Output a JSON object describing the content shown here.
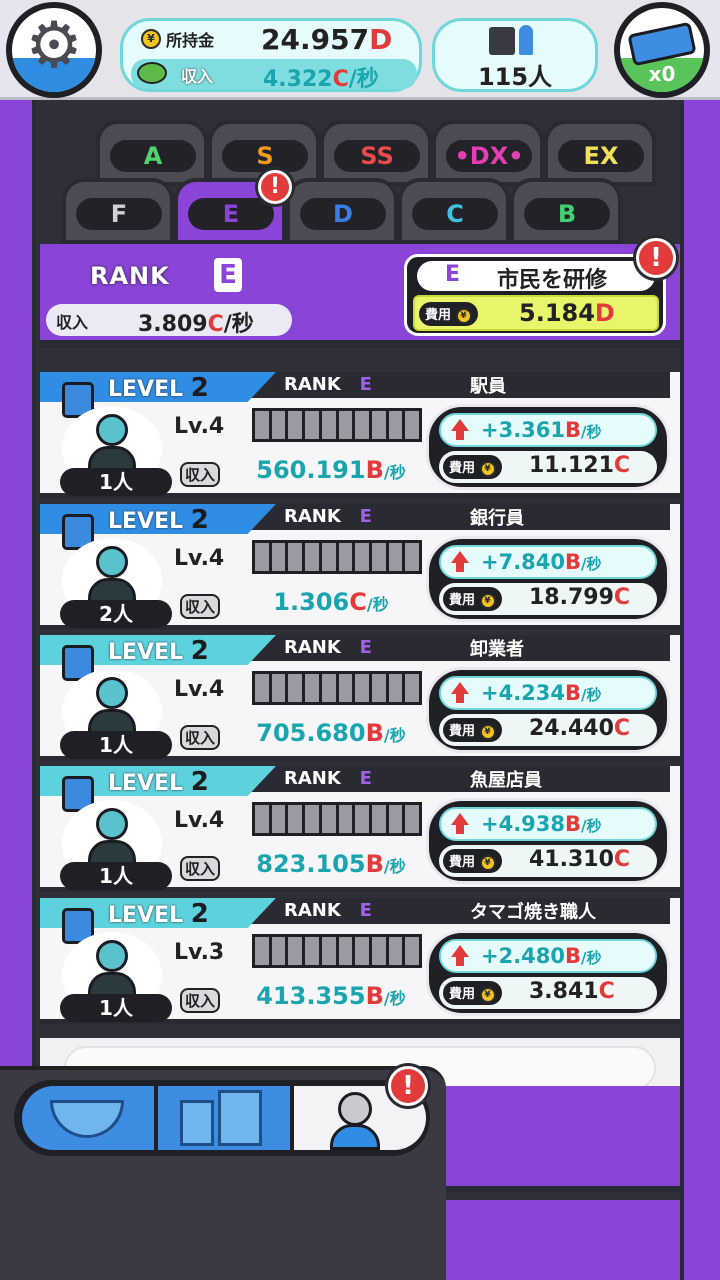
{
  "header": {
    "money_label": "所持金",
    "money_value": "24.957",
    "money_unit": "D",
    "income_label": "収入",
    "income_value": "4.322",
    "income_unit": "C",
    "income_suffix": "/秒",
    "population": "115人",
    "ticket_count": "x0",
    "yen_symbol": "¥"
  },
  "tabs_top": [
    {
      "label": "A",
      "color": "#4fd46a"
    },
    {
      "label": "S",
      "color": "#f39a1e"
    },
    {
      "label": "SS",
      "color": "#ec4a4a"
    },
    {
      "label": "•DX•",
      "color": "#e23fb2"
    },
    {
      "label": "EX",
      "color": "#f2e05a"
    }
  ],
  "tabs_bottom": [
    {
      "label": "F",
      "color": "#d0d0d6"
    },
    {
      "label": "E",
      "color": "#8a44d8",
      "active": true,
      "alert": "!"
    },
    {
      "label": "D",
      "color": "#3b7ee8"
    },
    {
      "label": "C",
      "color": "#3fc3e0"
    },
    {
      "label": "B",
      "color": "#43cf73"
    }
  ],
  "rank_header": {
    "rank_word": "RANK",
    "rank_letter": "E",
    "income_label": "収入",
    "income_value": "3.809",
    "income_unit": "C",
    "income_suffix": "/秒",
    "train_letter": "E",
    "train_title": "市民を研修",
    "cost_label": "費用",
    "cost_value": "5.184",
    "cost_unit": "D",
    "alert": "!"
  },
  "cards": [
    {
      "level_word": "LEVEL",
      "level": "2",
      "rank_word": "RANK",
      "rank": "E",
      "name": "駅員",
      "lv": "Lv.4",
      "count": "1人",
      "income_label": "収入",
      "income_value": "560.191",
      "income_unit": "B",
      "income_suffix": "/秒",
      "gain": "+3.361",
      "gain_unit": "B",
      "gain_suffix": "/秒",
      "cost_label": "費用",
      "cost_value": "11.121",
      "cost_unit": "C",
      "progress_filled": 0
    },
    {
      "level_word": "LEVEL",
      "level": "2",
      "rank_word": "RANK",
      "rank": "E",
      "name": "銀行員",
      "lv": "Lv.4",
      "count": "2人",
      "income_label": "収入",
      "income_value": "1.306",
      "income_unit": "C",
      "income_suffix": "/秒",
      "gain": "+7.840",
      "gain_unit": "B",
      "gain_suffix": "/秒",
      "cost_label": "費用",
      "cost_value": "18.799",
      "cost_unit": "C",
      "progress_filled": 0
    },
    {
      "level_word": "LEVEL",
      "level": "2",
      "rank_word": "RANK",
      "rank": "E",
      "name": "卸業者",
      "lv": "Lv.4",
      "count": "1人",
      "income_label": "収入",
      "income_value": "705.680",
      "income_unit": "B",
      "income_suffix": "/秒",
      "gain": "+4.234",
      "gain_unit": "B",
      "gain_suffix": "/秒",
      "cost_label": "費用",
      "cost_value": "24.440",
      "cost_unit": "C",
      "progress_filled": 0
    },
    {
      "level_word": "LEVEL",
      "level": "2",
      "rank_word": "RANK",
      "rank": "E",
      "name": "魚屋店員",
      "lv": "Lv.4",
      "count": "1人",
      "income_label": "収入",
      "income_value": "823.105",
      "income_unit": "B",
      "income_suffix": "/秒",
      "gain": "+4.938",
      "gain_unit": "B",
      "gain_suffix": "/秒",
      "cost_label": "費用",
      "cost_value": "41.310",
      "cost_unit": "C",
      "progress_filled": 0
    },
    {
      "level_word": "LEVEL",
      "level": "2",
      "rank_word": "RANK",
      "rank": "E",
      "name": "タマゴ焼き職人",
      "lv": "Lv.3",
      "count": "1人",
      "income_label": "収入",
      "income_value": "413.355",
      "income_unit": "B",
      "income_suffix": "/秒",
      "gain": "+2.480",
      "gain_unit": "B",
      "gain_suffix": "/秒",
      "cost_label": "費用",
      "cost_value": "3.841",
      "cost_unit": "C",
      "progress_filled": 0
    }
  ],
  "bottom_nav": {
    "items": [
      "shop-bowl-icon",
      "city-buildings-icon",
      "citizen-person-icon"
    ],
    "alert": "!"
  },
  "colors": {
    "purple": "#8a44d8",
    "teal": "#1aa5ae",
    "red": "#e23b3b",
    "blue": "#2f8de3"
  }
}
